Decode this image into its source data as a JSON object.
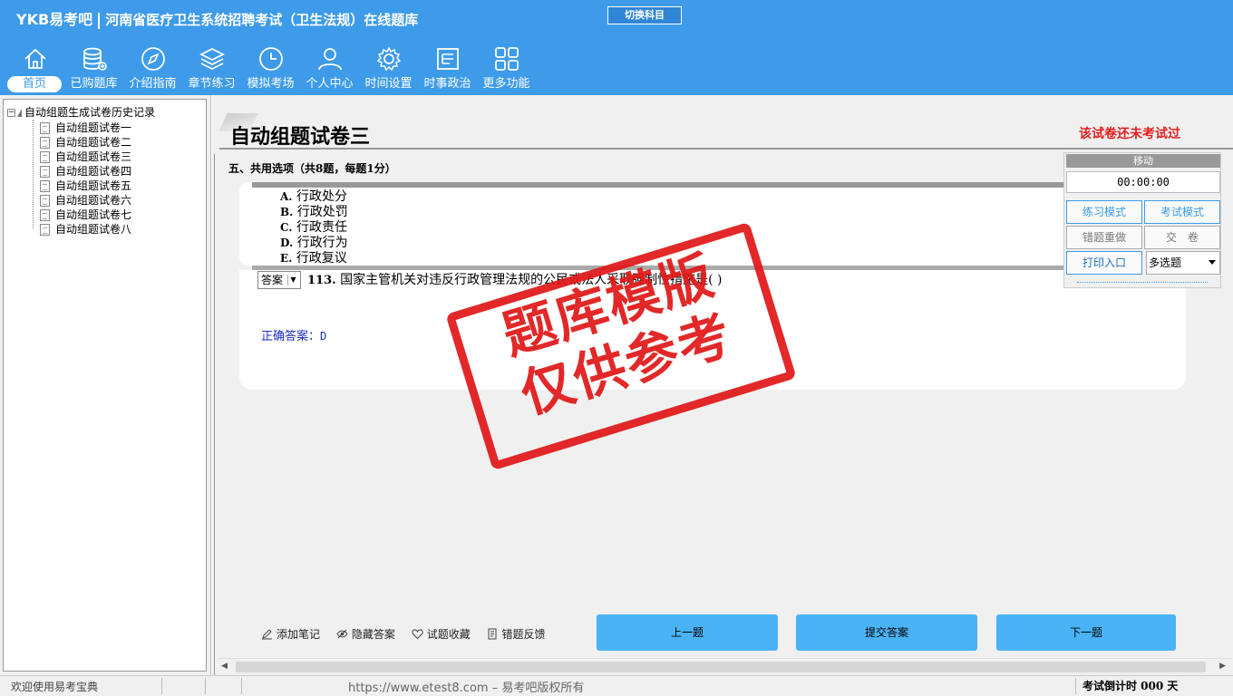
{
  "header": {
    "logo": "YKB易考吧",
    "title": "河南省医疗卫生系统招聘考试（卫生法规）在线题库",
    "switch_label": "切换科目"
  },
  "nav": {
    "items": [
      {
        "label": "首页",
        "icon": "home-icon"
      },
      {
        "label": "已购题库",
        "icon": "database-icon"
      },
      {
        "label": "介绍指南",
        "icon": "compass-icon"
      },
      {
        "label": "章节练习",
        "icon": "layers-icon"
      },
      {
        "label": "模拟考场",
        "icon": "clock-icon"
      },
      {
        "label": "个人中心",
        "icon": "user-icon"
      },
      {
        "label": "时间设置",
        "icon": "gear-icon"
      },
      {
        "label": "时事政治",
        "icon": "news-icon"
      },
      {
        "label": "更多功能",
        "icon": "grid-icon"
      }
    ]
  },
  "tree": {
    "root": "自动组题生成试卷历史记录",
    "items": [
      "自动组题试卷一",
      "自动组题试卷二",
      "自动组题试卷三",
      "自动组题试卷四",
      "自动组题试卷五",
      "自动组题试卷六",
      "自动组题试卷七",
      "自动组题试卷八"
    ]
  },
  "paper": {
    "title": "自动组题试卷三",
    "status": "该试卷还未考试过",
    "section": "五、共用选项（共8题，每题1分）"
  },
  "options": [
    {
      "key": "A.",
      "text": "行政处分"
    },
    {
      "key": "B.",
      "text": "行政处罚"
    },
    {
      "key": "C.",
      "text": "行政责任"
    },
    {
      "key": "D.",
      "text": "行政行为"
    },
    {
      "key": "E.",
      "text": "行政复议"
    }
  ],
  "question": {
    "answer_select": "答案",
    "number": "113.",
    "text": "国家主管机关对违反行政管理法规的公民或法人采取强制性措施是( )",
    "correct_label": "正确答案：",
    "correct_value": "D"
  },
  "panel": {
    "head": "移动",
    "timer": "00:00:00",
    "practice": "练习模式",
    "exam": "考试模式",
    "redo": "错题重做",
    "submit": "交　卷",
    "print": "打印入口",
    "mode": "多选题"
  },
  "tools": [
    {
      "label": "添加笔记",
      "icon": "pencil-icon"
    },
    {
      "label": "隐藏答案",
      "icon": "eye-icon"
    },
    {
      "label": "试题收藏",
      "icon": "heart-icon"
    },
    {
      "label": "错题反馈",
      "icon": "feedback-icon"
    }
  ],
  "buttons": {
    "prev": "上一题",
    "submit": "提交答案",
    "next": "下一题"
  },
  "statusbar": {
    "welcome": "欢迎使用易考宝典",
    "url": "https://www.etest8.com – 易考吧版权所有",
    "countdown": "考试倒计时 000 天"
  },
  "stamp": {
    "line1": "题库模版",
    "line2": "仅供参考"
  },
  "colors": {
    "brand": "#3d9be9",
    "stamp": "#e01818",
    "button": "#4ab3f6",
    "alert": "#e21e1e"
  }
}
